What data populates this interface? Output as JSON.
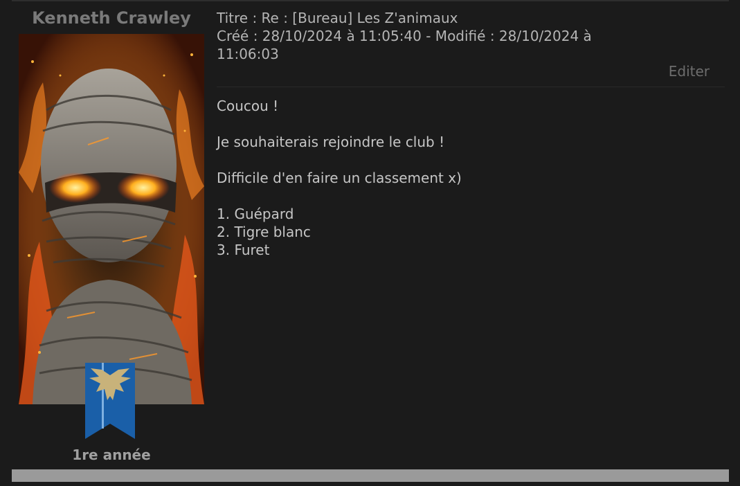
{
  "author": {
    "name": "Kenneth Crawley",
    "rank": "1re année",
    "avatar_icon": "mummy-avatar",
    "house_icon": "eagle-house-banner",
    "house_color": "#1a5fa8",
    "house_crest_color": "#c8b27a"
  },
  "post": {
    "title_line": "Titre : Re : [Bureau] Les Z'animaux",
    "created_line": "Créé : 28/10/2024 à 11:05:40 - Modifié : 28/10/2024 à",
    "created_line_cont": "11:06:03",
    "edit_label": "Editer",
    "paragraphs": [
      "Coucou !",
      "Je souhaiterais rejoindre le club !",
      "Difficile d'en faire un classement x)"
    ],
    "ranking": [
      "1. Guépard",
      "2. Tigre blanc",
      "3. Furet"
    ]
  },
  "colors": {
    "background": "#1b1b1b",
    "footer_bar": "#9a9a9a",
    "fire_accent": "#ff7a1a"
  }
}
